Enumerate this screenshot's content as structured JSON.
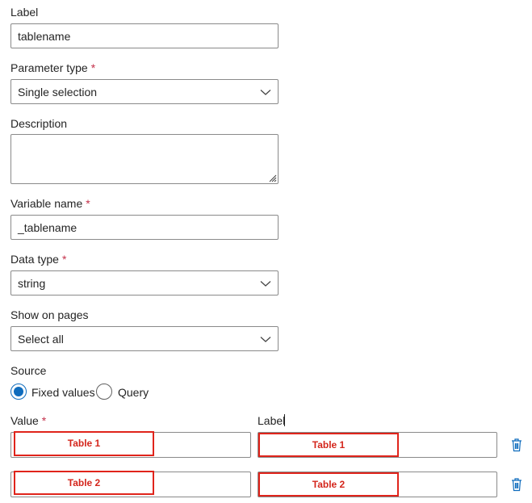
{
  "form": {
    "label_field": {
      "label": "Label",
      "value": "tablename"
    },
    "parameter_type": {
      "label": "Parameter type",
      "required": "*",
      "value": "Single selection"
    },
    "description": {
      "label": "Description",
      "value": ""
    },
    "variable_name": {
      "label": "Variable name",
      "required": "*",
      "value": "_tablename"
    },
    "data_type": {
      "label": "Data type",
      "required": "*",
      "value": "string"
    },
    "show_on_pages": {
      "label": "Show on pages",
      "value": "Select all"
    },
    "source": {
      "label": "Source",
      "options": [
        {
          "label": "Fixed values",
          "selected": true
        },
        {
          "label": "Query",
          "selected": false
        }
      ]
    },
    "values_table": {
      "value_header": "Value",
      "value_required": "*",
      "label_header": "Label",
      "rows": [
        {
          "value": "Table 1",
          "label": "Table 1"
        },
        {
          "value": "Table 2",
          "label": "Table 2"
        }
      ]
    }
  },
  "colors": {
    "accent": "#0f6cbd",
    "required": "#c4314b",
    "highlight": "#e0241b",
    "delete_icon": "#0f6cbd"
  },
  "icons": {
    "dropdown": "chevron-down-icon",
    "delete": "trash-icon",
    "resize": "resize-grip-icon"
  }
}
